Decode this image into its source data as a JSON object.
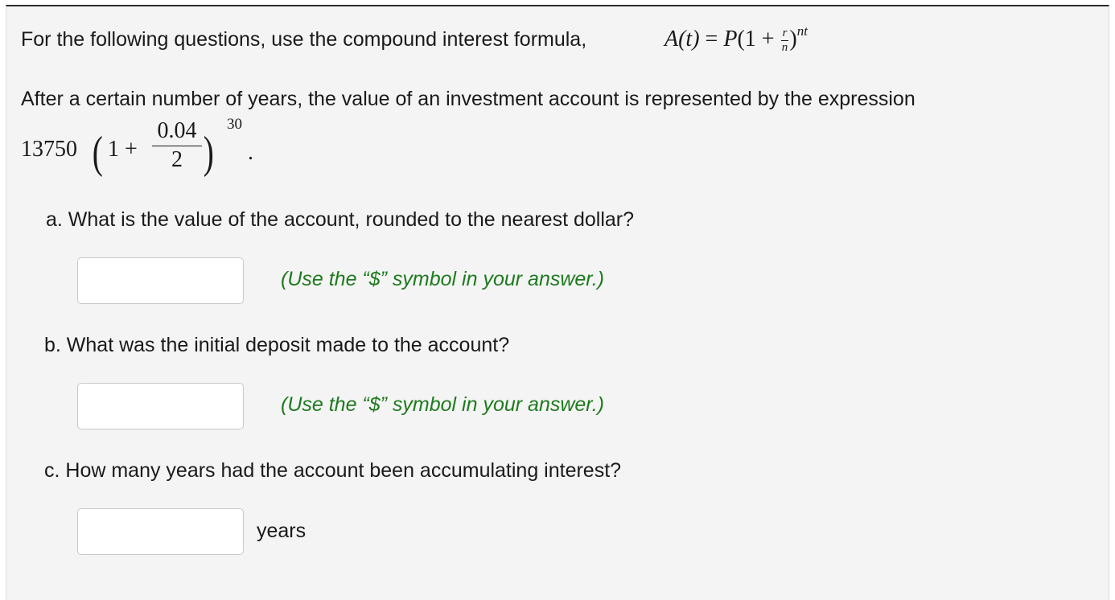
{
  "intro_text": "For the following questions, use the compound interest formula,",
  "formula": {
    "lhs": "A(t)",
    "eq": "=",
    "P": "P",
    "open": "(1 +",
    "r": "r",
    "n": "n",
    "close": ")",
    "exp": "nt"
  },
  "description": "After a certain number of years, the value of an investment account is represented by the expression",
  "expression": {
    "coefficient": "13750",
    "paren_left": "(",
    "one_plus": "1 +",
    "numerator": "0.04",
    "denominator": "2",
    "paren_right": ")",
    "exponent": "30",
    "period": "."
  },
  "questions": [
    {
      "label": "a. What is the value of the account, rounded to the nearest dollar?",
      "value": "",
      "hint": "(Use the “$” symbol in your answer.)"
    },
    {
      "label": "b. What was the initial deposit made to the account?",
      "value": "",
      "hint": "(Use the “$” symbol in your answer.)"
    },
    {
      "label": "c. How many years had the account been accumulating interest?",
      "value": "",
      "unit": "years"
    }
  ],
  "colors": {
    "hint_green": "#1e7a1e",
    "panel_bg": "#f4f4f4",
    "input_border": "#c9c9c9"
  }
}
